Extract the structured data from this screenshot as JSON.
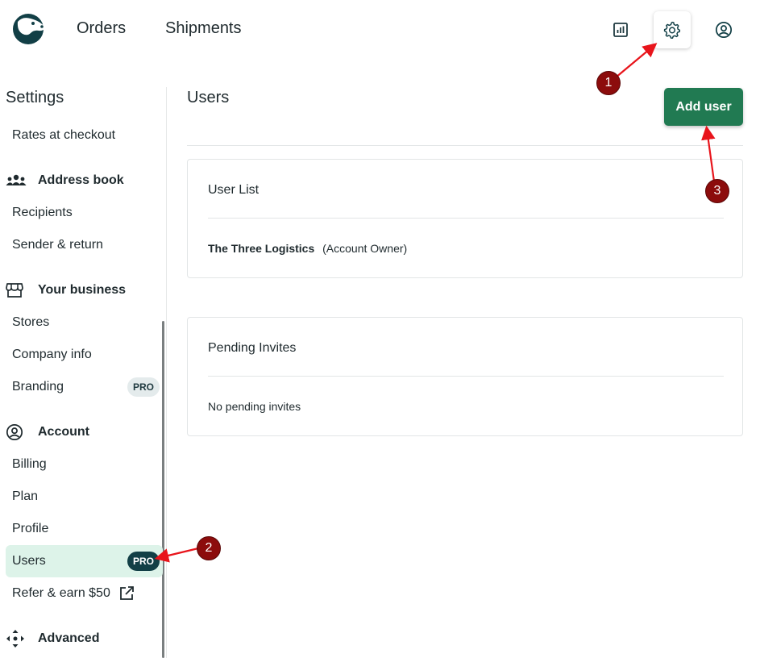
{
  "nav": {
    "orders": "Orders",
    "shipments": "Shipments",
    "icons": {
      "logo": "beaver-logo-icon",
      "reports": "bar-chart-icon",
      "settings": "gear-icon",
      "account": "user-circle-icon"
    }
  },
  "sidebar": {
    "title": "Settings",
    "rates": "Rates at checkout",
    "address_book": {
      "label": "Address book",
      "icon": "people-group-icon",
      "items": [
        "Recipients",
        "Sender & return"
      ]
    },
    "business": {
      "label": "Your business",
      "icon": "storefront-icon",
      "items": [
        "Stores",
        "Company info",
        "Branding"
      ],
      "branding_badge": "PRO"
    },
    "account": {
      "label": "Account",
      "icon": "user-circle-icon",
      "items": [
        "Billing",
        "Plan",
        "Profile",
        "Users"
      ],
      "users_badge": "PRO"
    },
    "refer": "Refer & earn $50",
    "advanced": {
      "label": "Advanced",
      "icon": "move-arrows-icon"
    }
  },
  "main": {
    "title": "Users",
    "add_button": "Add user",
    "user_list": {
      "title": "User List",
      "owner_name": "The Three Logistics",
      "owner_role": "(Account Owner)"
    },
    "pending": {
      "title": "Pending Invites",
      "empty": "No pending invites"
    }
  },
  "annotations": [
    "1",
    "2",
    "3"
  ],
  "colors": {
    "brand_green": "#217a52",
    "active_bg": "#ddf3e9",
    "badge_dark": "#123f46",
    "annotation_red": "#8c0c0c",
    "arrow_red": "#e8141b"
  }
}
